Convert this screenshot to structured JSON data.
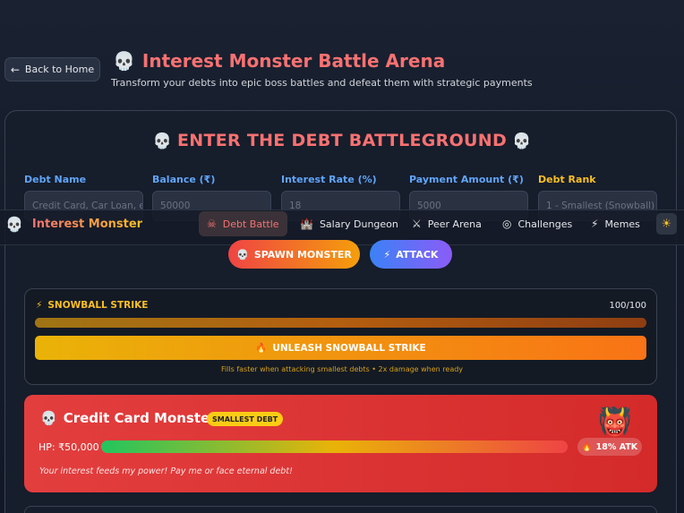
{
  "header": {
    "back_label": "Back to Home",
    "title": "Interest Monster Battle Arena",
    "subtitle": "Transform your debts into epic boss battles and defeat them with strategic payments"
  },
  "form": {
    "title": "ENTER THE DEBT BATTLEGROUND",
    "fields": [
      {
        "label": "Debt Name",
        "placeholder": "Credit Card, Car Loan, etc."
      },
      {
        "label": "Balance (₹)",
        "placeholder": "50000"
      },
      {
        "label": "Interest Rate (%)",
        "placeholder": "18"
      },
      {
        "label": "Payment Amount (₹)",
        "placeholder": "5000"
      },
      {
        "label": "Debt Rank",
        "value": "1 - Smallest (Snowball)"
      }
    ],
    "spawn_label": "SPAWN MONSTER",
    "attack_label": "ATTACK"
  },
  "nav": {
    "brand": "Interest Monster",
    "items": [
      {
        "label": "Debt Battle",
        "icon": "skull-icon"
      },
      {
        "label": "Salary Dungeon",
        "icon": "castle-icon"
      },
      {
        "label": "Peer Arena",
        "icon": "sword-icon"
      },
      {
        "label": "Challenges",
        "icon": "target-icon"
      },
      {
        "label": "Memes",
        "icon": "zap-icon"
      }
    ],
    "theme_icon": "sun-icon"
  },
  "snowball": {
    "title": "SNOWBALL STRIKE",
    "count": "100/100",
    "progress": 1.0,
    "button_label": "UNLEASH SNOWBALL STRIKE",
    "hint": "Fills faster when attacking smallest debts • 2x damage when ready"
  },
  "monster": {
    "name": "Credit Card Monster",
    "badge": "SMALLEST DEBT",
    "hp_label": "HP: ₹50,000",
    "hp_fraction": 1.0,
    "atk_label": "18% ATK",
    "taunt": "Your interest feeds my power! Pay me or face eternal debt!"
  },
  "colors": {
    "accent_red": "#f87171",
    "accent_yellow": "#fbbf24",
    "label_blue": "#60a5fa"
  }
}
